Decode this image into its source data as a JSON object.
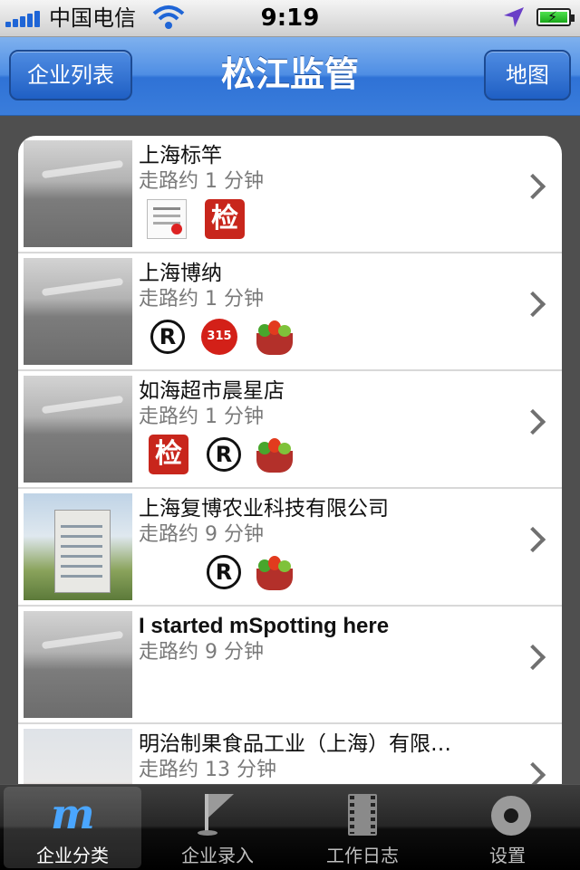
{
  "status_bar": {
    "carrier": "中国电信",
    "time": "9:19",
    "icons": [
      "signal-bars-icon",
      "wifi-icon",
      "location-arrow-icon",
      "battery-charging-icon"
    ]
  },
  "nav_bar": {
    "left_button": "企业列表",
    "title": "松江监管",
    "right_button": "地图"
  },
  "list": {
    "items": [
      {
        "name": "上海标竿",
        "distance": "走路约 1 分钟",
        "badges": [
          "certificate-icon",
          "inspection-jian-icon"
        ]
      },
      {
        "name": "上海博纳",
        "distance": "走路约 1 分钟",
        "badges": [
          "registered-trademark-icon",
          "315-icon",
          "vegetable-basket-icon"
        ]
      },
      {
        "name": "如海超市晨星店",
        "distance": "走路约 1 分钟",
        "badges": [
          "inspection-jian-icon",
          "registered-trademark-icon",
          "vegetable-basket-icon"
        ]
      },
      {
        "name": "上海复博农业科技有限公司",
        "distance": "走路约 9 分钟",
        "badges": [
          "registered-trademark-icon",
          "vegetable-basket-icon"
        ]
      },
      {
        "name": "I started mSpotting here",
        "distance": "走路约 9 分钟",
        "badges": []
      },
      {
        "name": "明治制果食品工业（上海）有限…",
        "distance": "走路约 13 分钟",
        "badges": []
      }
    ],
    "badge_text": {
      "jian": "检",
      "reg": "R",
      "three_one_five": "315"
    }
  },
  "tab_bar": {
    "tabs": [
      {
        "label": "企业分类",
        "icon": "m-logo-icon",
        "selected": true
      },
      {
        "label": "企业录入",
        "icon": "flag-icon",
        "selected": false
      },
      {
        "label": "工作日志",
        "icon": "film-journal-icon",
        "selected": false
      },
      {
        "label": "设置",
        "icon": "gear-icon",
        "selected": false
      }
    ]
  },
  "colors": {
    "nav_blue": "#3a7ddb",
    "accent_badge_red": "#c8261c",
    "tab_active_icon": "#4aa6ff"
  }
}
